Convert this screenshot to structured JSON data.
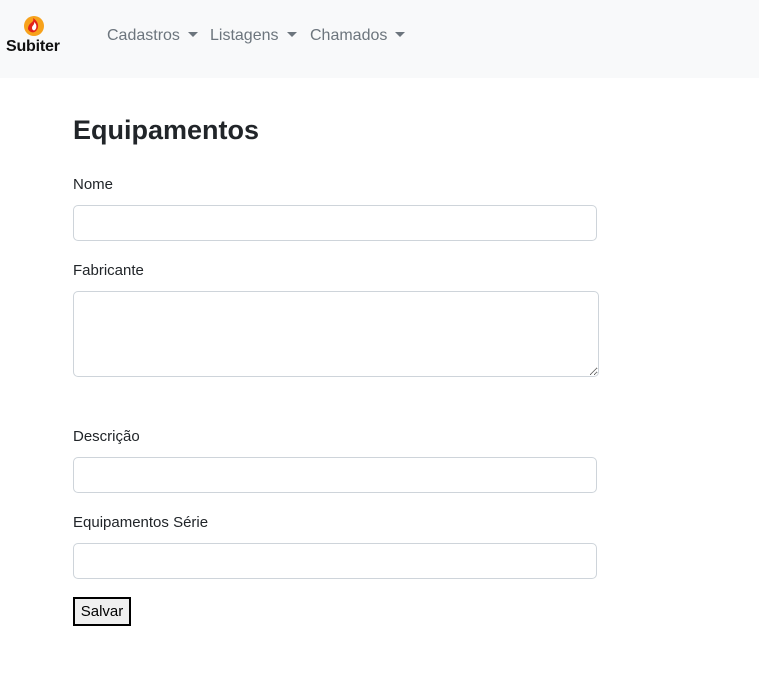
{
  "navbar": {
    "brand": {
      "text": "Subiter",
      "logo_icon": "flame-logo-icon",
      "logo_colors": [
        "#f7a21b",
        "#e2231a"
      ]
    },
    "items": [
      {
        "label": "Cadastros"
      },
      {
        "label": "Listagens"
      },
      {
        "label": "Chamados"
      }
    ]
  },
  "page": {
    "title": "Equipamentos"
  },
  "form": {
    "nome": {
      "label": "Nome",
      "value": ""
    },
    "fabricante": {
      "label": "Fabricante",
      "value": ""
    },
    "descricao": {
      "label": "Descrição",
      "value": ""
    },
    "serie": {
      "label": "Equipamentos Série",
      "value": ""
    },
    "save_label": "Salvar"
  },
  "colors": {
    "navbar_bg": "#f8f9fa",
    "nav_text": "#6c757d",
    "input_border": "#ced4da"
  }
}
